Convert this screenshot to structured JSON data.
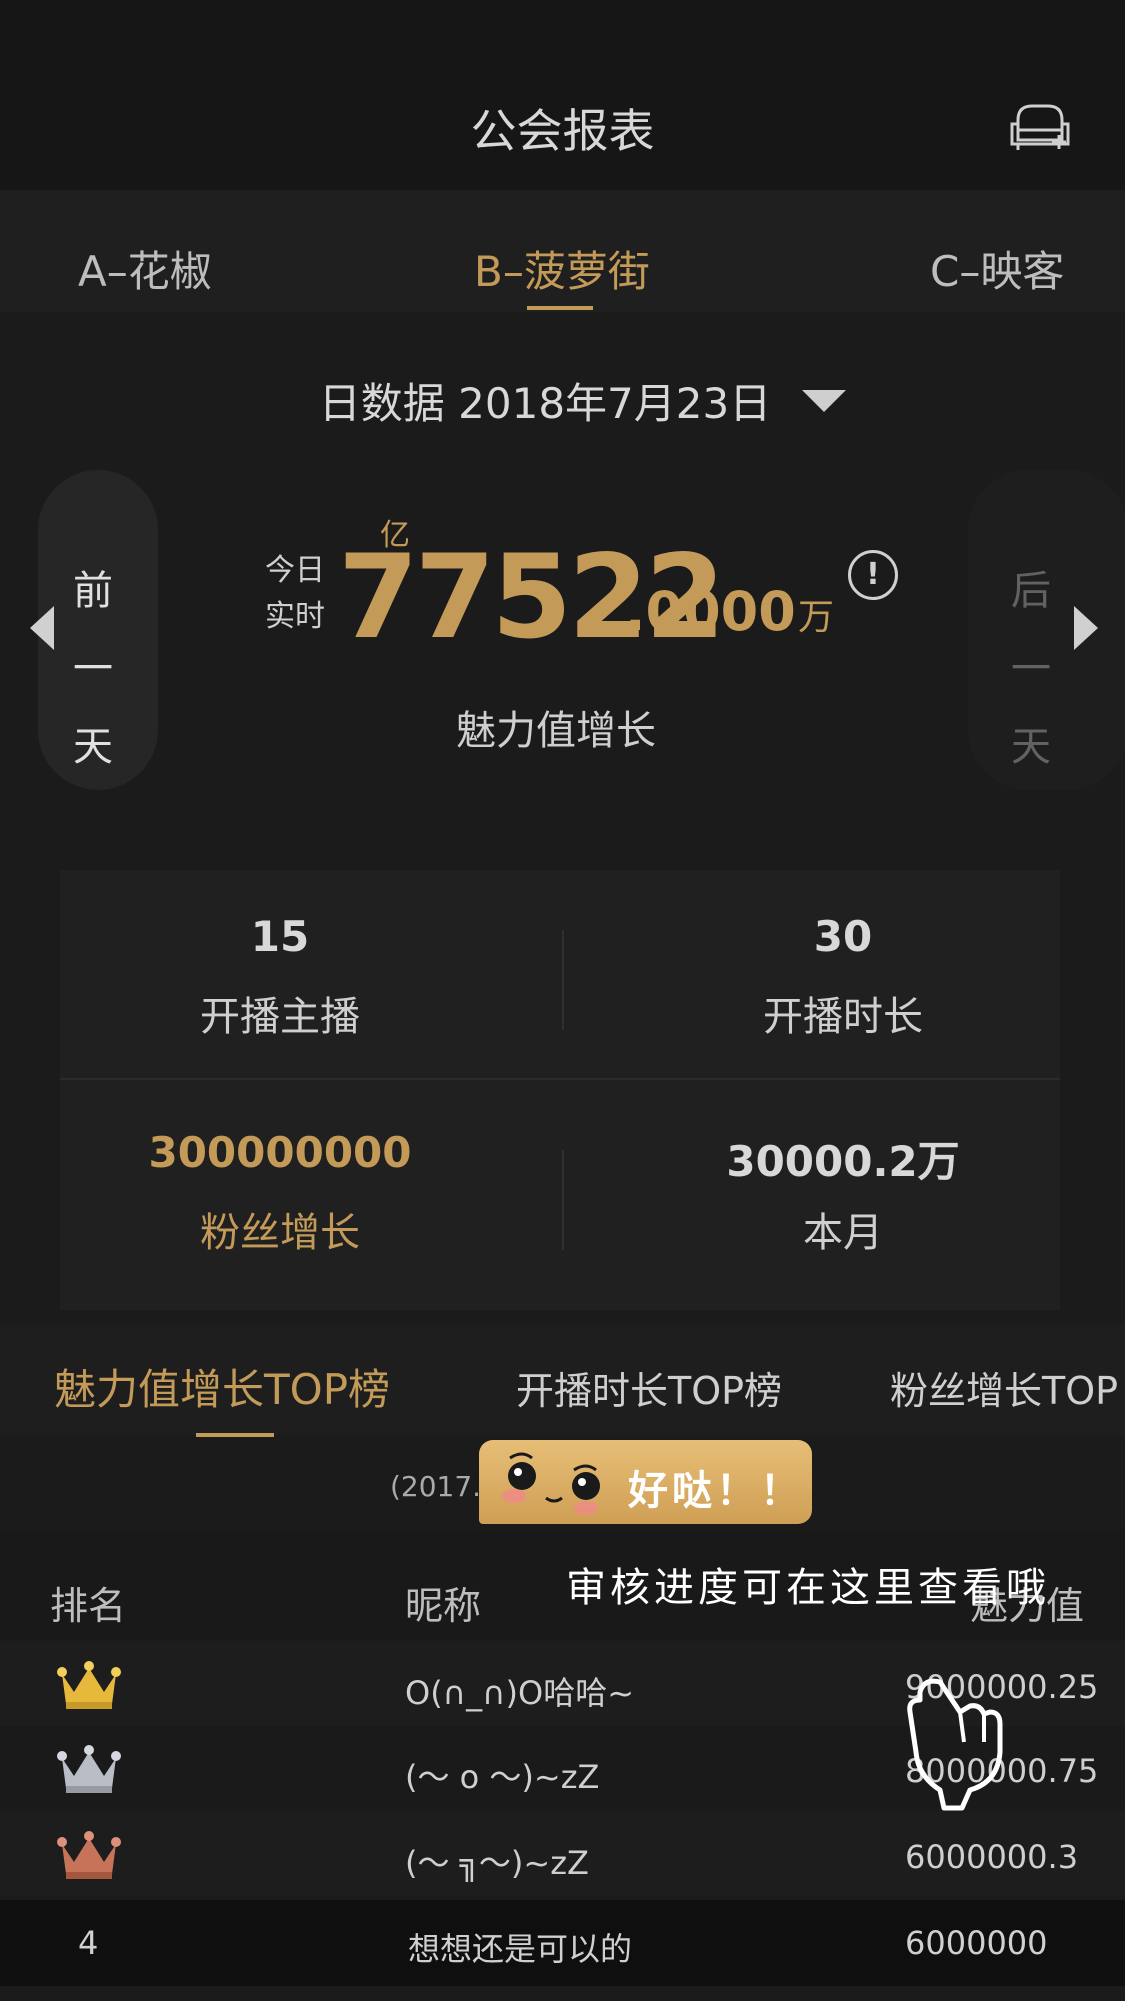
{
  "header": {
    "title": "公会报表",
    "icon": "sofa-add-icon"
  },
  "tabs": [
    {
      "label": "A–花椒"
    },
    {
      "label": "B–菠萝街",
      "active": true
    },
    {
      "label": "C–映客"
    }
  ],
  "date_selector": {
    "label": "日数据 2018年7月23日"
  },
  "metric": {
    "prev_label": [
      "前",
      "一",
      "天"
    ],
    "next_label": [
      "后",
      "一",
      "天"
    ],
    "today_label": [
      "今日",
      "实时"
    ],
    "unit_top": "亿",
    "value_int": "77522",
    "value_dec": ".0000",
    "unit_right": "万",
    "caption": "魅力值增长"
  },
  "stats": [
    {
      "value": "15",
      "label": "开播主播"
    },
    {
      "value": "30",
      "label": "开播时长"
    },
    {
      "value": "300000000",
      "label": "粉丝增长"
    },
    {
      "value": "30000.2万",
      "label": "本月"
    }
  ],
  "rank_tabs": [
    {
      "label": "魅力值增长TOP榜",
      "active": true
    },
    {
      "label": "开播时长TOP榜"
    },
    {
      "label": "粉丝增长TOP"
    }
  ],
  "subtitle": "(2017.",
  "table": {
    "headers": [
      "排名",
      "昵称",
      "魅力值"
    ],
    "rows": [
      {
        "rank": "1",
        "name": "O(∩_∩)O哈哈~",
        "value": "9000000.25"
      },
      {
        "rank": "2",
        "name": "(～ o ～)~zZ",
        "value": "8000000.75"
      },
      {
        "rank": "3",
        "name": "(～ ╗～)~zZ",
        "value": "6000000.3"
      },
      {
        "rank": "4",
        "name": "想想还是可以的",
        "value": "6000000"
      }
    ]
  },
  "tooltip": {
    "bubble_text": "好哒！！",
    "hint": "审核进度可在这里查看哦"
  },
  "colors": {
    "accent": "#c39a58",
    "background": "#1b1b1b",
    "bubble": "#dcae62"
  }
}
